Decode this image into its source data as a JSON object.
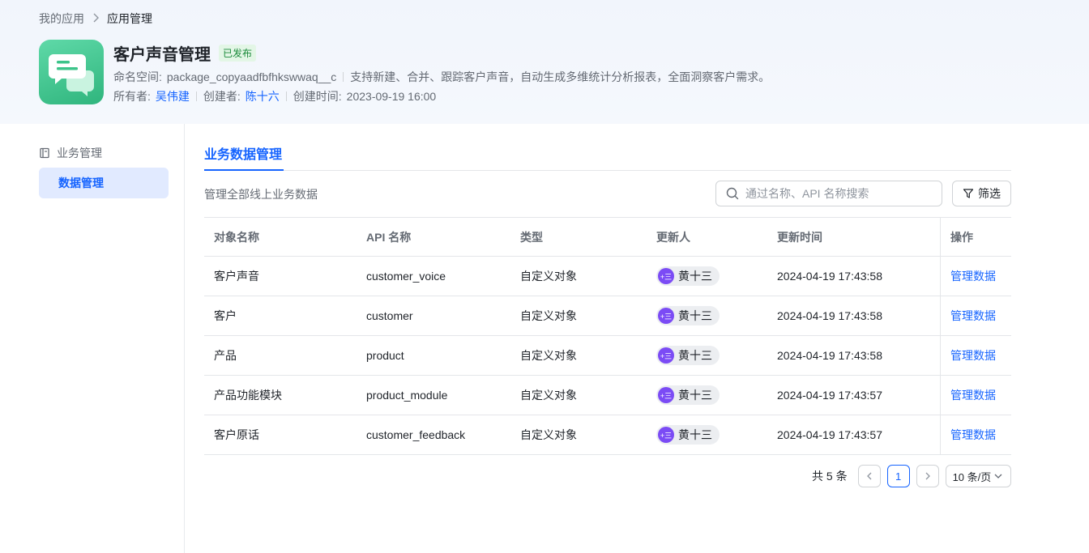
{
  "breadcrumb": {
    "root": "我的应用",
    "current": "应用管理"
  },
  "app": {
    "title": "客户声音管理",
    "status": "已发布",
    "namespace_label": "命名空间:",
    "namespace_value": "package_copyaadfbfhkswwaq__c",
    "description": "支持新建、合并、跟踪客户声音，自动生成多维统计分析报表，全面洞察客户需求。",
    "owner_label": "所有者:",
    "owner": "吴伟建",
    "creator_label": "创建者:",
    "creator": "陈十六",
    "created_label": "创建时间:",
    "created_at": "2023-09-19 16:00"
  },
  "sidebar": {
    "group_label": "业务管理",
    "items": [
      {
        "label": "数据管理"
      }
    ]
  },
  "tabs": [
    {
      "label": "业务数据管理"
    }
  ],
  "main": {
    "description": "管理全部线上业务数据",
    "search_placeholder": "通过名称、API 名称搜索",
    "filter_label": "筛选"
  },
  "table": {
    "headers": [
      "对象名称",
      "API 名称",
      "类型",
      "更新人",
      "更新时间",
      "操作"
    ],
    "rows": [
      {
        "name": "客户声音",
        "api": "customer_voice",
        "type": "自定义对象",
        "updater": "黄十三",
        "updater_avatar": "+三",
        "updated": "2024-04-19 17:43:58",
        "action": "管理数据"
      },
      {
        "name": "客户",
        "api": "customer",
        "type": "自定义对象",
        "updater": "黄十三",
        "updater_avatar": "+三",
        "updated": "2024-04-19 17:43:58",
        "action": "管理数据"
      },
      {
        "name": "产品",
        "api": "product",
        "type": "自定义对象",
        "updater": "黄十三",
        "updater_avatar": "+三",
        "updated": "2024-04-19 17:43:58",
        "action": "管理数据"
      },
      {
        "name": "产品功能模块",
        "api": "product_module",
        "type": "自定义对象",
        "updater": "黄十三",
        "updater_avatar": "+三",
        "updated": "2024-04-19 17:43:57",
        "action": "管理数据"
      },
      {
        "name": "客户原话",
        "api": "customer_feedback",
        "type": "自定义对象",
        "updater": "黄十三",
        "updater_avatar": "+三",
        "updated": "2024-04-19 17:43:57",
        "action": "管理数据"
      }
    ]
  },
  "pagination": {
    "total": "共 5 条",
    "current_page": "1",
    "page_size": "10 条/页"
  },
  "colors": {
    "primary": "#1664ff",
    "published_bg": "#e3f6e6",
    "published_text": "#1a8a3a",
    "avatar": "#7b4bf5",
    "app_icon": "#3cc48a"
  },
  "icons": {
    "app": "chat-bubbles-icon",
    "sidebar_group": "book-icon",
    "search": "search-icon",
    "filter": "filter-icon",
    "prev": "chevron-left-icon",
    "next": "chevron-right-icon",
    "dropdown": "chevron-down-icon",
    "breadcrumb_sep": "chevron-right-icon"
  }
}
